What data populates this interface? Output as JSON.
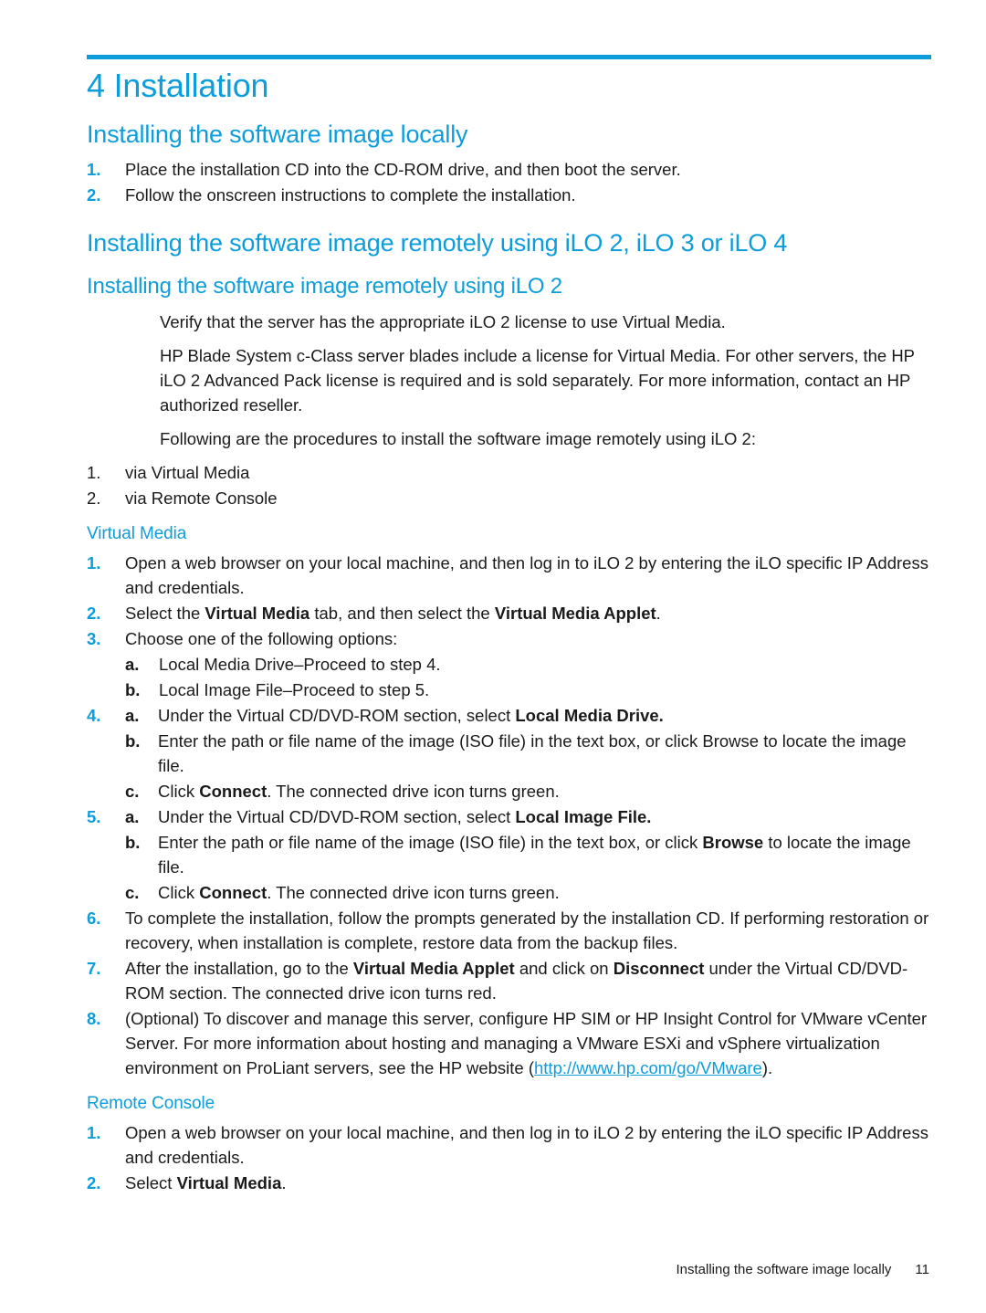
{
  "theme": {
    "accent": "#0d9ddb",
    "text": "#1a1a1a",
    "background": "#ffffff"
  },
  "chapter": {
    "title": "4 Installation"
  },
  "sections": {
    "local": {
      "heading": "Installing the software image locally",
      "steps": [
        {
          "num": "1.",
          "text": "Place the installation CD into the CD-ROM drive, and then boot the server."
        },
        {
          "num": "2.",
          "text": "Follow the onscreen instructions to complete the installation."
        }
      ]
    },
    "remote": {
      "heading": "Installing the software image remotely using iLO 2, iLO 3 or iLO 4",
      "subheading": "Installing the software image remotely using iLO 2",
      "para1": "Verify that the server has the appropriate iLO 2 license to use Virtual Media.",
      "para2": "HP Blade System c-Class server blades include a license for Virtual Media. For other servers, the HP iLO 2 Advanced Pack license is required and is sold separately. For more information, contact an HP authorized reseller.",
      "para3": "Following are the procedures to install the software image remotely using iLO 2:",
      "methods": [
        {
          "num": "1.",
          "text": "via Virtual Media"
        },
        {
          "num": "2.",
          "text": "via Remote Console"
        }
      ]
    },
    "virtual_media": {
      "heading": "Virtual Media",
      "steps": [
        {
          "num": "1.",
          "text": "Open a web browser on your local machine, and then log in to iLO 2 by entering the iLO specific IP Address and credentials."
        },
        {
          "num": "2.",
          "pre": "Select the ",
          "bold1": "Virtual Media",
          "mid": " tab, and then select the ",
          "bold2": "Virtual Media Applet",
          "post": "."
        },
        {
          "num": "3.",
          "text": "Choose one of the following options:",
          "sub": [
            {
              "num": "a.",
              "text": "Local Media Drive–Proceed to step 4."
            },
            {
              "num": "b.",
              "text": "Local Image File–Proceed to step 5."
            }
          ]
        },
        {
          "num": "4.",
          "sub": [
            {
              "num": "a.",
              "pre": "Under the Virtual CD/DVD-ROM section, select ",
              "bold": "Local Media Drive.",
              "post": ""
            },
            {
              "num": "b.",
              "pre": "Enter the path or file name of the image (ISO file) in the text box, or click Browse to locate the image file.",
              "bold": "",
              "post": ""
            },
            {
              "num": "c.",
              "pre": "Click ",
              "bold": "Connect",
              "post": ". The connected drive icon turns green."
            }
          ]
        },
        {
          "num": "5.",
          "sub": [
            {
              "num": "a.",
              "pre": "Under the Virtual CD/DVD-ROM section, select ",
              "bold": "Local Image File.",
              "post": ""
            },
            {
              "num": "b.",
              "pre": "Enter the path or file name of the image (ISO file) in the text box, or click ",
              "bold": "Browse",
              "post": " to locate the image file."
            },
            {
              "num": "c.",
              "pre": "Click ",
              "bold": "Connect",
              "post": ". The connected drive icon turns green."
            }
          ]
        },
        {
          "num": "6.",
          "text": "To complete the installation, follow the prompts generated by the installation CD. If performing restoration or recovery, when installation is complete, restore data from the backup files."
        },
        {
          "num": "7.",
          "pre": "After the installation, go to the ",
          "bold1": "Virtual Media Applet",
          "mid": " and click on ",
          "bold2": "Disconnect",
          "post": " under the Virtual CD/DVD-ROM section. The connected drive icon turns red."
        },
        {
          "num": "8.",
          "pre": "(Optional) To discover and manage this server, configure HP SIM or HP Insight Control for VMware vCenter Server. For more information about hosting and managing a VMware ESXi and vSphere virtualization environment on ProLiant servers, see the HP website (",
          "link": "http://www.hp.com/go/VMware",
          "post": ")."
        }
      ]
    },
    "remote_console": {
      "heading": "Remote Console",
      "steps": [
        {
          "num": "1.",
          "text": "Open a web browser on your local machine, and then log in to iLO 2 by entering the iLO specific IP Address and credentials."
        },
        {
          "num": "2.",
          "pre": "Select ",
          "bold1": "Virtual Media",
          "post": "."
        }
      ]
    }
  },
  "footer": {
    "title": "Installing the software image locally",
    "page": "11"
  }
}
